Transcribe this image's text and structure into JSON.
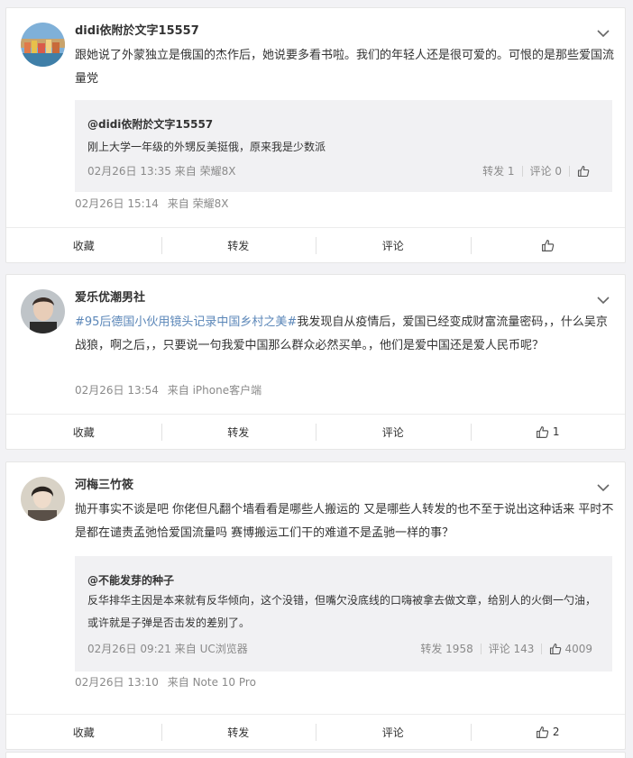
{
  "posts": [
    {
      "username": "didi依附於文字15557",
      "text": "跟她说了外蒙独立是俄国的杰作后，她说要多看书啦。我们的年轻人还是很可爱的。可恨的是那些爱国流量党",
      "quote": {
        "username": "@didi依附於文字15557",
        "text": "刚上大学一年级的外甥反美挺俄，原来我是少数派",
        "date": "02月26日 13:35",
        "source": "来自 荣耀8X",
        "reposts": "转发 1",
        "comments": "评论 0",
        "likes": ""
      },
      "date": "02月26日 15:14",
      "source": "来自 荣耀8X",
      "actions": {
        "collect": "收藏",
        "repost": "转发",
        "comment": "评论",
        "like_count": ""
      }
    },
    {
      "username": "爱乐优潮男社",
      "tag": "#95后德国小伙用镜头记录中国乡村之美#",
      "text": "我发现自从疫情后，爱国已经变成财富流量密码，，什么吴京战狼，啊之后，，只要说一句我爱中国那么群众必然买单。，他们是爱中国还是爱人民币呢？",
      "date": "02月26日 13:54",
      "source": "来自 iPhone客户端",
      "actions": {
        "collect": "收藏",
        "repost": "转发",
        "comment": "评论",
        "like_count": "1"
      }
    },
    {
      "username": "河梅三竹筱",
      "text": "抛开事实不谈是吧 你佬但凡翻个墙看看是哪些人搬运的 又是哪些人转发的也不至于说出这种话来 平时不是都在谴责孟弛恰爱国流量吗 赛博搬运工们干的难道不是孟驰一样的事？",
      "quote": {
        "username": "@不能发芽的种子",
        "text": "反华排华主因是本来就有反华倾向，这个没错，但嘴欠没底线的口嗨被拿去做文章，给别人的火倒一勺油，或许就是子弹是否击发的差别了。",
        "date": "02月26日 09:21",
        "source": "来自 UC浏览器",
        "reposts": "转发 1958",
        "comments": "评论 143",
        "likes": "4009"
      },
      "date": "02月26日 13:10",
      "source": "来自 Note 10 Pro",
      "actions": {
        "collect": "收藏",
        "repost": "转发",
        "comment": "评论",
        "like_count": "2"
      }
    }
  ],
  "colors": {
    "link": "#5a86b8",
    "meta": "#8a8a8a",
    "quote_bg": "#f1f1f3",
    "page_bg": "#f2f2f5"
  },
  "icons": {
    "more": "chevron-down-icon",
    "like": "thumbs-up-icon"
  }
}
